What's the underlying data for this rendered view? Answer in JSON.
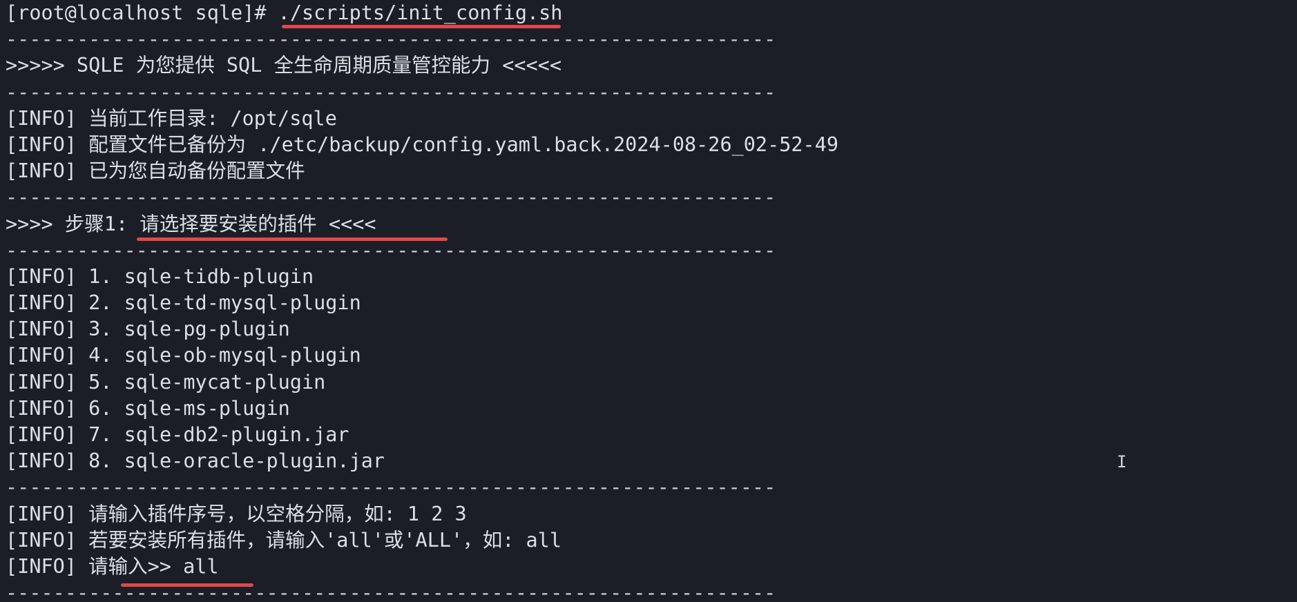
{
  "terminal": {
    "prompt": "[root@localhost sqle]# ",
    "command": "./scripts/init_config.sh",
    "separator": "-----------------------------------------------------------------",
    "banner": ">>>>> SQLE 为您提供 SQL 全生命周期质量管控能力 <<<<<",
    "info_top": [
      "[INFO] 当前工作目录: /opt/sqle",
      "[INFO] 配置文件已备份为 ./etc/backup/config.yaml.back.2024-08-26_02-52-49",
      "[INFO] 已为您自动备份配置文件"
    ],
    "step_prefix": ">>>> 步骤1: ",
    "step_title": "请选择要安装的插件",
    "step_suffix": " <<<<",
    "plugins": [
      "[INFO] 1. sqle-tidb-plugin",
      "[INFO] 2. sqle-td-mysql-plugin",
      "[INFO] 3. sqle-pg-plugin",
      "[INFO] 4. sqle-ob-mysql-plugin",
      "[INFO] 5. sqle-mycat-plugin",
      "[INFO] 6. sqle-ms-plugin",
      "[INFO] 7. sqle-db2-plugin.jar",
      "[INFO] 8. sqle-oracle-plugin.jar"
    ],
    "hint_1": "[INFO] 请输入插件序号，以空格分隔，如: 1 2 3",
    "hint_2": "[INFO] 若要安装所有插件，请输入'all'或'ALL'，如: all",
    "input_prefix": "[INFO] ",
    "input_prompt": "请输入>> ",
    "input_value": "all"
  },
  "colors": {
    "background": "#1b1e27",
    "text": "#dcdfe4",
    "annotation_underline": "#e04848"
  }
}
